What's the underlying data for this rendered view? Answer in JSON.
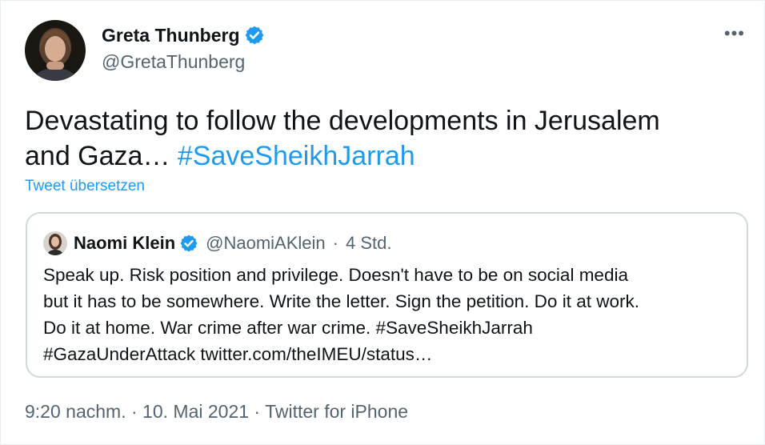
{
  "tweet": {
    "author": {
      "display_name": "Greta Thunberg",
      "handle": "@GretaThunberg",
      "verified": true,
      "avatar_icon": "profile-photo"
    },
    "more_icon": "more-horizontal-icon",
    "more_label": "•••",
    "text": {
      "line1": "Devastating to follow the developments in Jerusalem",
      "line2_prefix": "and Gaza… ",
      "hashtag": "#SaveSheikhJarrah"
    },
    "translate_label": "Tweet übersetzen",
    "quoted": {
      "display_name": "Naomi Klein",
      "handle": "@NaomiAKlein",
      "separator": "·",
      "time": "4 Std.",
      "verified": true,
      "lines": [
        "Speak up. Risk position and privilege. Doesn't have to be on social media",
        "but it has to be somewhere. Write the letter. Sign the petition. Do it at work.",
        "Do it at home. War crime after war crime. #SaveSheikhJarrah",
        "#GazaUnderAttack twitter.com/theIMEU/status…"
      ]
    },
    "meta": {
      "time": "9:20 nachm.",
      "separator": "·",
      "date": "10. Mai 2021",
      "source": "Twitter for iPhone"
    },
    "colors": {
      "accent": "#1d9bf0",
      "secondary_text": "#536471",
      "border": "#cfd9de"
    }
  }
}
